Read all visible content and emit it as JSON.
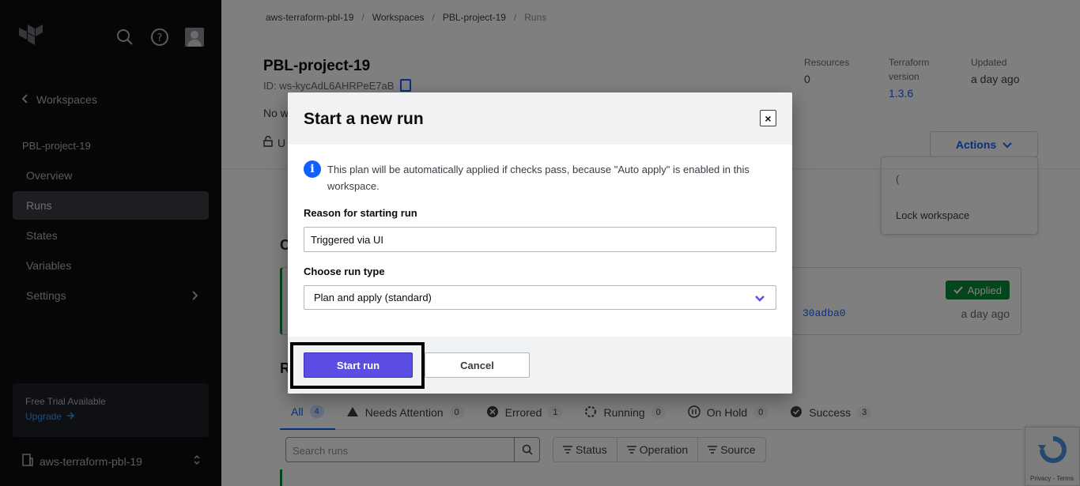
{
  "sidebar": {
    "back_label": "Workspaces",
    "workspace_name": "PBL-project-19",
    "nav": [
      {
        "label": "Overview"
      },
      {
        "label": "Runs"
      },
      {
        "label": "States"
      },
      {
        "label": "Variables"
      },
      {
        "label": "Settings"
      }
    ],
    "trial": {
      "title": "Free Trial Available",
      "link": "Upgrade"
    },
    "org": "aws-terraform-pbl-19"
  },
  "breadcrumb": [
    "aws-terraform-pbl-19",
    "Workspaces",
    "PBL-project-19",
    "Runs"
  ],
  "workspace": {
    "title": "PBL-project-19",
    "id": "ID: ws-kycAdL6AHRPeE7aB",
    "desc": "No w",
    "lock": "U"
  },
  "meta": {
    "resources_label": "Resources",
    "resources_value": "0",
    "tf_label_1": "Terraform",
    "tf_label_2": "version",
    "tf_value": "1.3.6",
    "updated_label": "Updated",
    "updated_value": "a day ago"
  },
  "actions": {
    "label": "Actions",
    "menu": [
      "(",
      "Lock workspace"
    ]
  },
  "current_run": {
    "heading": "C",
    "badge": "Applied",
    "commit": "30adba0",
    "time": "a day ago"
  },
  "runs": {
    "heading": "R",
    "tabs": [
      {
        "label": "All",
        "count": "4"
      },
      {
        "label": "Needs Attention",
        "count": "0"
      },
      {
        "label": "Errored",
        "count": "1"
      },
      {
        "label": "Running",
        "count": "0"
      },
      {
        "label": "On Hold",
        "count": "0"
      },
      {
        "label": "Success",
        "count": "3"
      }
    ],
    "search_placeholder": "Search runs",
    "filters": [
      "Status",
      "Operation",
      "Source"
    ]
  },
  "recaptcha": {
    "footer": "Privacy - Terms"
  },
  "modal": {
    "title": "Start a new run",
    "close": "×",
    "info": "This plan will be automatically applied if checks pass, because \"Auto apply\" is enabled in this workspace.",
    "reason_label": "Reason for starting run",
    "reason_value": "Triggered via UI",
    "type_label": "Choose run type",
    "type_value": "Plan and apply (standard)",
    "start_label": "Start run",
    "cancel_label": "Cancel"
  },
  "colors": {
    "primary": "#5c4ee5",
    "link": "#1060ff",
    "success": "#0a8a3a",
    "sidebar": "#0c0c0e"
  }
}
